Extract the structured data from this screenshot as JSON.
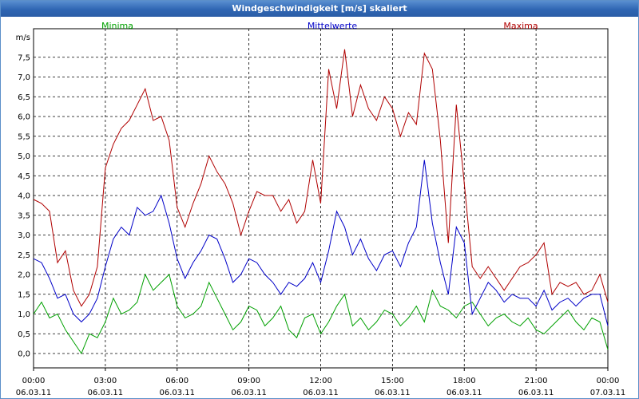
{
  "window": {
    "title": "Windgeschwindigkeit [m/s] skaliert"
  },
  "chart_data": {
    "type": "line",
    "title": "Windgeschwindigkeit [m/s] skaliert",
    "ylabel": "m/s",
    "ylim": [
      0,
      8
    ],
    "xlim": [
      0,
      24
    ],
    "grid": true,
    "legend_position": "top",
    "y_ticks": [
      "0,0",
      "0,5",
      "1,0",
      "1,5",
      "2,0",
      "2,5",
      "3,0",
      "3,5",
      "4,0",
      "4,5",
      "5,0",
      "5,5",
      "6,0",
      "6,5",
      "7,0",
      "7,5"
    ],
    "x_ticks": [
      {
        "time": "00:00",
        "date": "06.03.11"
      },
      {
        "time": "03:00",
        "date": "06.03.11"
      },
      {
        "time": "06:00",
        "date": "06.03.11"
      },
      {
        "time": "09:00",
        "date": "06.03.11"
      },
      {
        "time": "12:00",
        "date": "06.03.11"
      },
      {
        "time": "15:00",
        "date": "06.03.11"
      },
      {
        "time": "18:00",
        "date": "06.03.11"
      },
      {
        "time": "21:00",
        "date": "06.03.11"
      },
      {
        "time": "00:00",
        "date": "07.03.11"
      }
    ],
    "x": [
      0,
      0.333,
      0.667,
      1,
      1.333,
      1.667,
      2,
      2.333,
      2.667,
      3,
      3.333,
      3.667,
      4,
      4.333,
      4.667,
      5,
      5.333,
      5.667,
      6,
      6.333,
      6.667,
      7,
      7.333,
      7.667,
      8,
      8.333,
      8.667,
      9,
      9.333,
      9.667,
      10,
      10.333,
      10.667,
      11,
      11.333,
      11.667,
      12,
      12.333,
      12.667,
      13,
      13.333,
      13.667,
      14,
      14.333,
      14.667,
      15,
      15.333,
      15.667,
      16,
      16.333,
      16.667,
      17,
      17.333,
      17.667,
      18,
      18.333,
      18.667,
      19,
      19.333,
      19.667,
      20,
      20.333,
      20.667,
      21,
      21.333,
      21.667,
      22,
      22.333,
      22.667,
      23,
      23.333,
      23.667,
      24
    ],
    "series": [
      {
        "name": "Minima",
        "color": "#00a000",
        "values": [
          1.0,
          1.3,
          0.9,
          1.0,
          0.6,
          0.3,
          0.0,
          0.5,
          0.4,
          0.8,
          1.4,
          1.0,
          1.1,
          1.3,
          2.0,
          1.6,
          1.8,
          2.0,
          1.2,
          0.9,
          1.0,
          1.2,
          1.8,
          1.4,
          1.0,
          0.6,
          0.8,
          1.2,
          1.1,
          0.7,
          0.9,
          1.2,
          0.6,
          0.4,
          0.9,
          1.0,
          0.5,
          0.8,
          1.2,
          1.5,
          0.7,
          0.9,
          0.6,
          0.8,
          1.1,
          1.0,
          0.7,
          0.9,
          1.2,
          0.8,
          1.6,
          1.2,
          1.1,
          0.9,
          1.2,
          1.3,
          1.0,
          0.7,
          0.9,
          1.0,
          0.8,
          0.7,
          0.9,
          0.6,
          0.5,
          0.7,
          0.9,
          1.1,
          0.8,
          0.6,
          0.9,
          0.8,
          0.1
        ]
      },
      {
        "name": "Mittelwerte",
        "color": "#0000c8",
        "values": [
          2.4,
          2.3,
          1.9,
          1.4,
          1.5,
          1.0,
          0.8,
          1.0,
          1.4,
          2.2,
          2.9,
          3.2,
          3.0,
          3.7,
          3.5,
          3.6,
          4.0,
          3.3,
          2.4,
          1.9,
          2.3,
          2.6,
          3.0,
          2.9,
          2.4,
          1.8,
          2.0,
          2.4,
          2.3,
          2.0,
          1.8,
          1.5,
          1.8,
          1.7,
          1.9,
          2.3,
          1.8,
          2.6,
          3.6,
          3.2,
          2.5,
          2.9,
          2.4,
          2.1,
          2.5,
          2.6,
          2.2,
          2.8,
          3.2,
          4.9,
          3.3,
          2.3,
          1.5,
          3.2,
          2.8,
          1.0,
          1.4,
          1.8,
          1.6,
          1.3,
          1.5,
          1.4,
          1.4,
          1.2,
          1.6,
          1.1,
          1.3,
          1.4,
          1.2,
          1.4,
          1.5,
          1.5,
          0.7
        ]
      },
      {
        "name": "Maxima",
        "color": "#b00000",
        "values": [
          3.9,
          3.8,
          3.6,
          2.3,
          2.6,
          1.6,
          1.2,
          1.5,
          2.2,
          4.7,
          5.3,
          5.7,
          5.9,
          6.3,
          6.7,
          5.9,
          6.0,
          5.4,
          3.7,
          3.2,
          3.8,
          4.3,
          5.0,
          4.6,
          4.3,
          3.8,
          3.0,
          3.6,
          4.1,
          4.0,
          4.0,
          3.6,
          3.9,
          3.3,
          3.6,
          4.9,
          3.8,
          7.2,
          6.2,
          7.7,
          6.0,
          6.8,
          6.2,
          5.9,
          6.5,
          6.2,
          5.5,
          6.1,
          5.8,
          7.6,
          7.2,
          5.4,
          2.8,
          6.3,
          4.3,
          2.2,
          1.9,
          2.2,
          1.9,
          1.6,
          1.9,
          2.2,
          2.3,
          2.5,
          2.8,
          1.5,
          1.8,
          1.7,
          1.8,
          1.5,
          1.6,
          2.0,
          1.3
        ]
      }
    ]
  }
}
